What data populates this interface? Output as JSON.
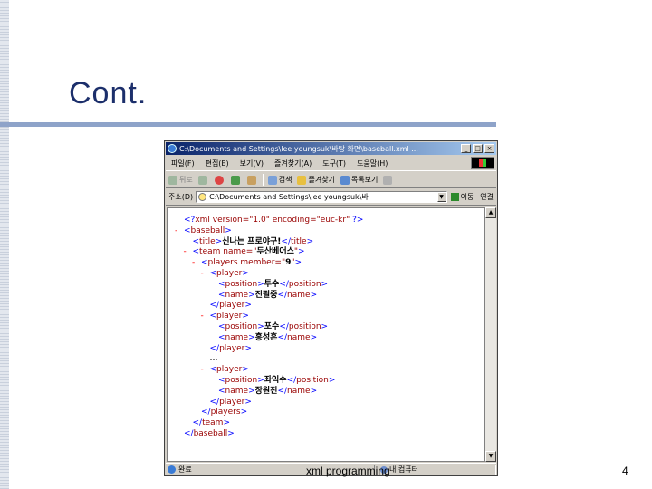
{
  "slide": {
    "title": "Cont.",
    "footer": "xml programming",
    "page_number": "4",
    "accent_color": "#8ea3c9",
    "title_color": "#1c2f6b"
  },
  "browser": {
    "title": "C:\\Documents and Settings\\lee youngsuk\\바탕 화면\\baseball.xml ...",
    "window_buttons": [
      "_",
      "□",
      "×"
    ],
    "menu": [
      "파일(F)",
      "편집(E)",
      "보기(V)",
      "즐겨찾기(A)",
      "도구(T)",
      "도움말(H)"
    ],
    "toolbar": {
      "back": "뒤로",
      "search": "검색",
      "favorites": "즐겨찾기",
      "history": "목록보기"
    },
    "address_label": "주소(D)",
    "address_value": "C:\\Documents and Settings\\lee youngsuk\\바",
    "go_label": "이동",
    "links_label": "연결",
    "status_left": "완료",
    "status_right": "내 컴퓨터"
  },
  "xml_lines": [
    {
      "marker": "",
      "indent": 0,
      "parts": [
        [
          "b",
          "<?"
        ],
        [
          "tg",
          "xml version=\"1.0\" encoding=\"euc-kr\" "
        ],
        [
          "b",
          "?>"
        ]
      ]
    },
    {
      "marker": "-",
      "indent": 0,
      "parts": [
        [
          "b",
          "<"
        ],
        [
          "tg",
          "baseball"
        ],
        [
          "b",
          ">"
        ]
      ]
    },
    {
      "marker": "",
      "indent": 1,
      "parts": [
        [
          "b",
          "<"
        ],
        [
          "tg",
          "title"
        ],
        [
          "b",
          ">"
        ],
        [
          "tx",
          "신나는 프로야구!"
        ],
        [
          "b",
          "</"
        ],
        [
          "tg",
          "title"
        ],
        [
          "b",
          ">"
        ]
      ]
    },
    {
      "marker": "-",
      "indent": 1,
      "parts": [
        [
          "b",
          "<"
        ],
        [
          "tg",
          "team"
        ],
        [
          "an",
          " name=\""
        ],
        [
          "tx",
          "두산베어스"
        ],
        [
          "an",
          "\""
        ],
        [
          "b",
          ">"
        ]
      ]
    },
    {
      "marker": "-",
      "indent": 2,
      "parts": [
        [
          "b",
          "<"
        ],
        [
          "tg",
          "players"
        ],
        [
          "an",
          " member=\""
        ],
        [
          "tx",
          "9"
        ],
        [
          "an",
          "\""
        ],
        [
          "b",
          ">"
        ]
      ]
    },
    {
      "marker": "-",
      "indent": 3,
      "parts": [
        [
          "b",
          "<"
        ],
        [
          "tg",
          "player"
        ],
        [
          "b",
          ">"
        ]
      ]
    },
    {
      "marker": "",
      "indent": 4,
      "parts": [
        [
          "b",
          "<"
        ],
        [
          "tg",
          "position"
        ],
        [
          "b",
          ">"
        ],
        [
          "tx",
          "투수"
        ],
        [
          "b",
          "</"
        ],
        [
          "tg",
          "position"
        ],
        [
          "b",
          ">"
        ]
      ]
    },
    {
      "marker": "",
      "indent": 4,
      "parts": [
        [
          "b",
          "<"
        ],
        [
          "tg",
          "name"
        ],
        [
          "b",
          ">"
        ],
        [
          "tx",
          "진필중"
        ],
        [
          "b",
          "</"
        ],
        [
          "tg",
          "name"
        ],
        [
          "b",
          ">"
        ]
      ]
    },
    {
      "marker": "",
      "indent": 3,
      "parts": [
        [
          "b",
          "</"
        ],
        [
          "tg",
          "player"
        ],
        [
          "b",
          ">"
        ]
      ]
    },
    {
      "marker": "-",
      "indent": 3,
      "parts": [
        [
          "b",
          "<"
        ],
        [
          "tg",
          "player"
        ],
        [
          "b",
          ">"
        ]
      ]
    },
    {
      "marker": "",
      "indent": 4,
      "parts": [
        [
          "b",
          "<"
        ],
        [
          "tg",
          "position"
        ],
        [
          "b",
          ">"
        ],
        [
          "tx",
          "포수"
        ],
        [
          "b",
          "</"
        ],
        [
          "tg",
          "position"
        ],
        [
          "b",
          ">"
        ]
      ]
    },
    {
      "marker": "",
      "indent": 4,
      "parts": [
        [
          "b",
          "<"
        ],
        [
          "tg",
          "name"
        ],
        [
          "b",
          ">"
        ],
        [
          "tx",
          "홍성흔"
        ],
        [
          "b",
          "</"
        ],
        [
          "tg",
          "name"
        ],
        [
          "b",
          ">"
        ]
      ]
    },
    {
      "marker": "",
      "indent": 3,
      "parts": [
        [
          "b",
          "</"
        ],
        [
          "tg",
          "player"
        ],
        [
          "b",
          ">"
        ]
      ]
    },
    {
      "marker": "",
      "indent": 3,
      "parts": [
        [
          "tx",
          "…"
        ]
      ]
    },
    {
      "marker": "-",
      "indent": 3,
      "parts": [
        [
          "b",
          "<"
        ],
        [
          "tg",
          "player"
        ],
        [
          "b",
          ">"
        ]
      ]
    },
    {
      "marker": "",
      "indent": 4,
      "parts": [
        [
          "b",
          "<"
        ],
        [
          "tg",
          "position"
        ],
        [
          "b",
          ">"
        ],
        [
          "tx",
          "좌익수"
        ],
        [
          "b",
          "</"
        ],
        [
          "tg",
          "position"
        ],
        [
          "b",
          ">"
        ]
      ]
    },
    {
      "marker": "",
      "indent": 4,
      "parts": [
        [
          "b",
          "<"
        ],
        [
          "tg",
          "name"
        ],
        [
          "b",
          ">"
        ],
        [
          "tx",
          "장원진"
        ],
        [
          "b",
          "</"
        ],
        [
          "tg",
          "name"
        ],
        [
          "b",
          ">"
        ]
      ]
    },
    {
      "marker": "",
      "indent": 3,
      "parts": [
        [
          "b",
          "</"
        ],
        [
          "tg",
          "player"
        ],
        [
          "b",
          ">"
        ]
      ]
    },
    {
      "marker": "",
      "indent": 2,
      "parts": [
        [
          "b",
          "</"
        ],
        [
          "tg",
          "players"
        ],
        [
          "b",
          ">"
        ]
      ]
    },
    {
      "marker": "",
      "indent": 1,
      "parts": [
        [
          "b",
          "</"
        ],
        [
          "tg",
          "team"
        ],
        [
          "b",
          ">"
        ]
      ]
    },
    {
      "marker": "",
      "indent": 0,
      "parts": [
        [
          "b",
          "</"
        ],
        [
          "tg",
          "baseball"
        ],
        [
          "b",
          ">"
        ]
      ]
    }
  ]
}
